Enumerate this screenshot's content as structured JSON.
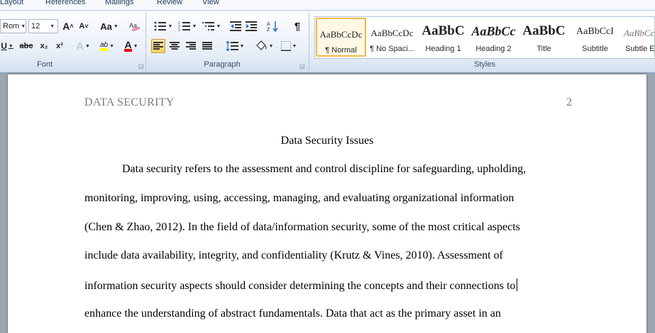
{
  "tabs": [
    "Layout",
    "References",
    "Mailings",
    "Review",
    "View"
  ],
  "font_group": {
    "font_name": "Rom",
    "font_size": "12",
    "grow_label": "A",
    "shrink_label": "A",
    "case_label": "Aa",
    "underline_label": "U",
    "strike_label": "abc",
    "subscript_label": "x₂",
    "superscript_label": "x²",
    "effects_label": "A",
    "highlight_label": "ab",
    "font_color_label": "A",
    "group_label": "Font",
    "highlight_color": "#ffff00",
    "font_color": "#e00000"
  },
  "paragraph_group": {
    "group_label": "Paragraph",
    "pilcrow": "¶"
  },
  "styles_group": {
    "group_label": "Styles",
    "tiles": [
      {
        "preview": "AaBbCcDc",
        "name": "¶ Normal"
      },
      {
        "preview": "AaBbCcDc",
        "name": "¶ No Spaci..."
      },
      {
        "preview": "AaBbC",
        "name": "Heading 1"
      },
      {
        "preview": "AaBbCc",
        "name": "Heading 2"
      },
      {
        "preview": "AaBbC",
        "name": "Title"
      },
      {
        "preview": "AaBbCcI",
        "name": "Subtitle"
      },
      {
        "preview": "AaBbCc",
        "name": "Subtle E"
      }
    ]
  },
  "document": {
    "header_title": "DATA SECURITY",
    "header_page": "2",
    "title": "Data Security Issues",
    "lines": [
      "Data security refers to the assessment and control discipline for safeguarding, upholding,",
      "monitoring, improving, using, accessing, managing, and evaluating organizational information",
      "(Chen & Zhao, 2012). In the field of data/information security, some of the most critical aspects",
      "include data availability, integrity, and confidentiality (Krutz & Vines, 2010). Assessment of",
      "information security aspects should consider determining the concepts and their connections to",
      "enhance the understanding of abstract fundamentals. Data that act as the primary asset in an"
    ]
  }
}
